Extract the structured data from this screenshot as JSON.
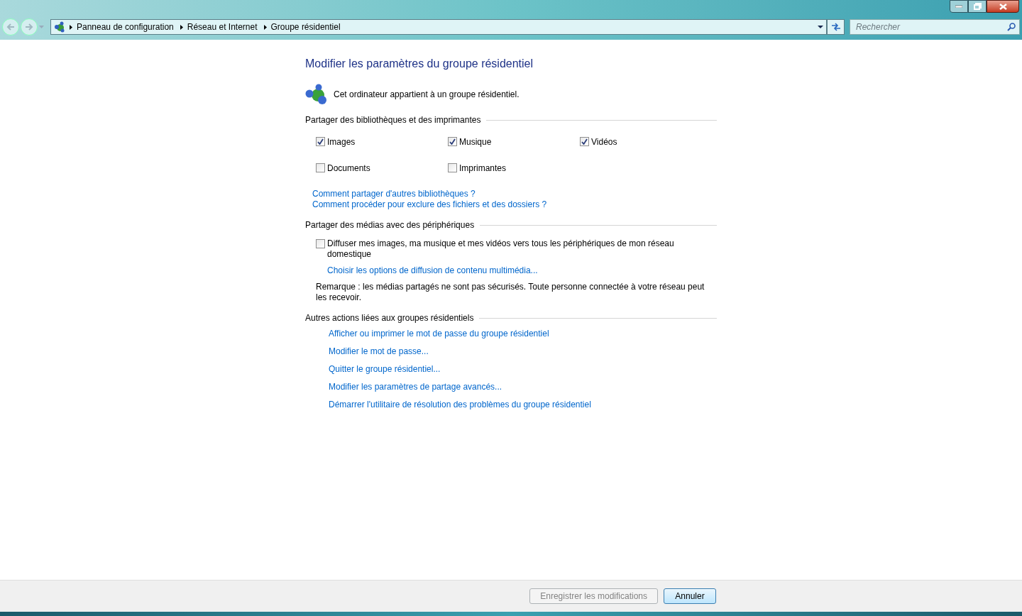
{
  "address_bar": {
    "breadcrumbs": [
      "Panneau de configuration",
      "Réseau et Internet",
      "Groupe résidentiel"
    ]
  },
  "search": {
    "placeholder": "Rechercher"
  },
  "page": {
    "title": "Modifier les paramètres du groupe résidentiel",
    "status": "Cet ordinateur appartient à un groupe résidentiel.",
    "sections": [
      {
        "heading": "Partager des bibliothèques et des imprimantes",
        "items": [
          {
            "kind": "checkbox",
            "label": "Images",
            "checked": true
          },
          {
            "kind": "checkbox",
            "label": "Musique",
            "checked": true
          },
          {
            "kind": "checkbox",
            "label": "Vidéos",
            "checked": true
          },
          {
            "kind": "checkbox",
            "label": "Documents",
            "checked": false
          },
          {
            "kind": "checkbox",
            "label": "Imprimantes",
            "checked": false
          }
        ],
        "links": [
          "Comment partager d'autres bibliothèques ?",
          "Comment procéder pour exclure des fichiers et des dossiers ?"
        ]
      },
      {
        "heading": "Partager des médias avec des périphériques",
        "media": {
          "label": "Diffuser mes images, ma musique et mes vidéos vers tous les périphériques de mon réseau domestique",
          "checked": false,
          "link": "Choisir les options de diffusion de contenu multimédia...",
          "note": "Remarque : les médias partagés ne sont pas sécurisés. Toute personne connectée à votre réseau peut les recevoir."
        }
      },
      {
        "heading": "Autres actions liées aux groupes résidentiels",
        "actions": [
          "Afficher ou imprimer le mot de passe du groupe résidentiel",
          "Modifier le mot de passe...",
          "Quitter le groupe résidentiel...",
          "Modifier les paramètres de partage avancés...",
          "Démarrer l'utilitaire de résolution des problèmes du groupe résidentiel"
        ]
      }
    ]
  },
  "buttons": [
    {
      "label": "Enregistrer les modifications",
      "disabled": true
    },
    {
      "label": "Annuler",
      "disabled": false
    }
  ]
}
